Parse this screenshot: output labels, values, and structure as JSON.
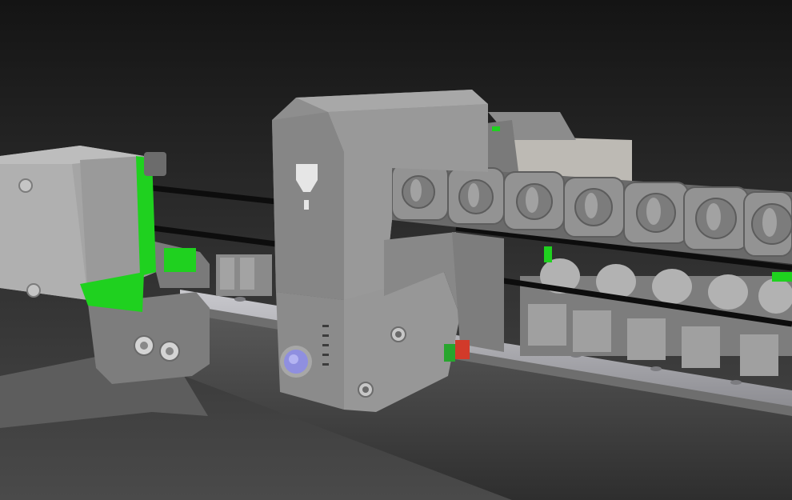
{
  "scene": {
    "subject": "3d-printer-x-axis-carriage-render",
    "colors": {
      "background_top": "#141414",
      "background_bottom": "#4a4a4a",
      "part_gray": "#8e8e8e",
      "part_light": "#a9a9a9",
      "part_dark": "#5f5f5f",
      "accent_green": "#1fd11f",
      "belt_black": "#0d0d0d",
      "pulley_blue": "#8f8fe0",
      "rail_silver": "#b7b7bc",
      "marker_red": "#d23a2a",
      "motor_cover": "#bdbab4"
    },
    "icons": [
      "hotend-arrow-icon"
    ]
  }
}
